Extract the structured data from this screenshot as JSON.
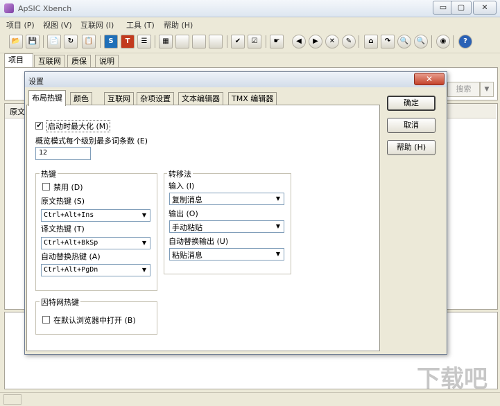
{
  "window": {
    "title": "ApSIC Xbench",
    "controls": {
      "minimize": "▭",
      "maximize": "▢",
      "close": "✕"
    }
  },
  "menu": [
    "项目 (P)",
    "视图 (V)",
    "互联网 (I)",
    "工具 (T)",
    "帮助 (H)"
  ],
  "toolbar_icons": [
    {
      "name": "open-folder-icon",
      "glyph": "📂"
    },
    {
      "name": "save-icon",
      "glyph": "💾"
    },
    {
      "name": "add-files-icon",
      "glyph": "📄"
    },
    {
      "name": "refresh-icon",
      "glyph": "↻"
    },
    {
      "name": "properties-icon",
      "glyph": "📋"
    },
    {
      "name": "source-icon",
      "glyph": "S"
    },
    {
      "name": "target-icon",
      "glyph": "T"
    },
    {
      "name": "list-icon",
      "glyph": "☰"
    },
    {
      "name": "color-grid-icon",
      "glyph": "▦"
    },
    {
      "name": "blank-1-icon",
      "glyph": ""
    },
    {
      "name": "blank-2-icon",
      "glyph": ""
    },
    {
      "name": "blank-3-icon",
      "glyph": ""
    },
    {
      "name": "check-icon",
      "glyph": "✔"
    },
    {
      "name": "checklist-icon",
      "glyph": "☑"
    },
    {
      "name": "hand-icon",
      "glyph": "☛"
    },
    {
      "name": "back-icon",
      "glyph": "◀"
    },
    {
      "name": "forward-icon",
      "glyph": "▶"
    },
    {
      "name": "stop-icon",
      "glyph": "✕"
    },
    {
      "name": "edit-icon",
      "glyph": "✎"
    },
    {
      "name": "home-icon",
      "glyph": "⌂"
    },
    {
      "name": "redo-icon",
      "glyph": "↷"
    },
    {
      "name": "zoom-in-icon",
      "glyph": "🔍"
    },
    {
      "name": "zoom-out-icon",
      "glyph": "🔍"
    },
    {
      "name": "globe-icon",
      "glyph": "◉"
    },
    {
      "name": "help-icon",
      "glyph": "?"
    }
  ],
  "main_tabs": [
    "项目",
    "互联网",
    "质保",
    "说明"
  ],
  "search": {
    "button_label": "搜索"
  },
  "list_header": {
    "source_col": "原文"
  },
  "dialog": {
    "title": "设置",
    "tabs": [
      "布局热键",
      "颜色",
      "互联网",
      "杂项设置",
      "文本编辑器",
      "TMX 编辑器"
    ],
    "buttons": {
      "ok": "确定",
      "cancel": "取消",
      "help": "帮助 (H)"
    },
    "maximize_on_start": {
      "label": "启动时最大化 (M)",
      "checked": true
    },
    "overview_max_label": "概览模式每个级别最多词条数 (E)",
    "overview_max_value": "12",
    "hotkeys": {
      "group_label": "热键",
      "disable_label": "禁用 (D)",
      "disable_checked": false,
      "source_label": "原文热键 (S)",
      "source_value": "Ctrl+Alt+Ins",
      "target_label": "译文热键 (T)",
      "target_value": "Ctrl+Alt+BkSp",
      "autoreplace_label": "自动替换热键 (A)",
      "autoreplace_value": "Ctrl+Alt+PgDn"
    },
    "transfer": {
      "group_label": "转移法",
      "input_label": "输入 (I)",
      "input_value": "复制消息",
      "output_label": "输出 (O)",
      "output_value": "手动粘贴",
      "autoreplace_output_label": "自动替换输出 (U)",
      "autoreplace_output_value": "粘贴消息"
    },
    "internet_hotkey": {
      "group_label": "因特网热键",
      "open_in_browser_label": "在默认浏览器中打开 (B)",
      "checked": false
    }
  }
}
